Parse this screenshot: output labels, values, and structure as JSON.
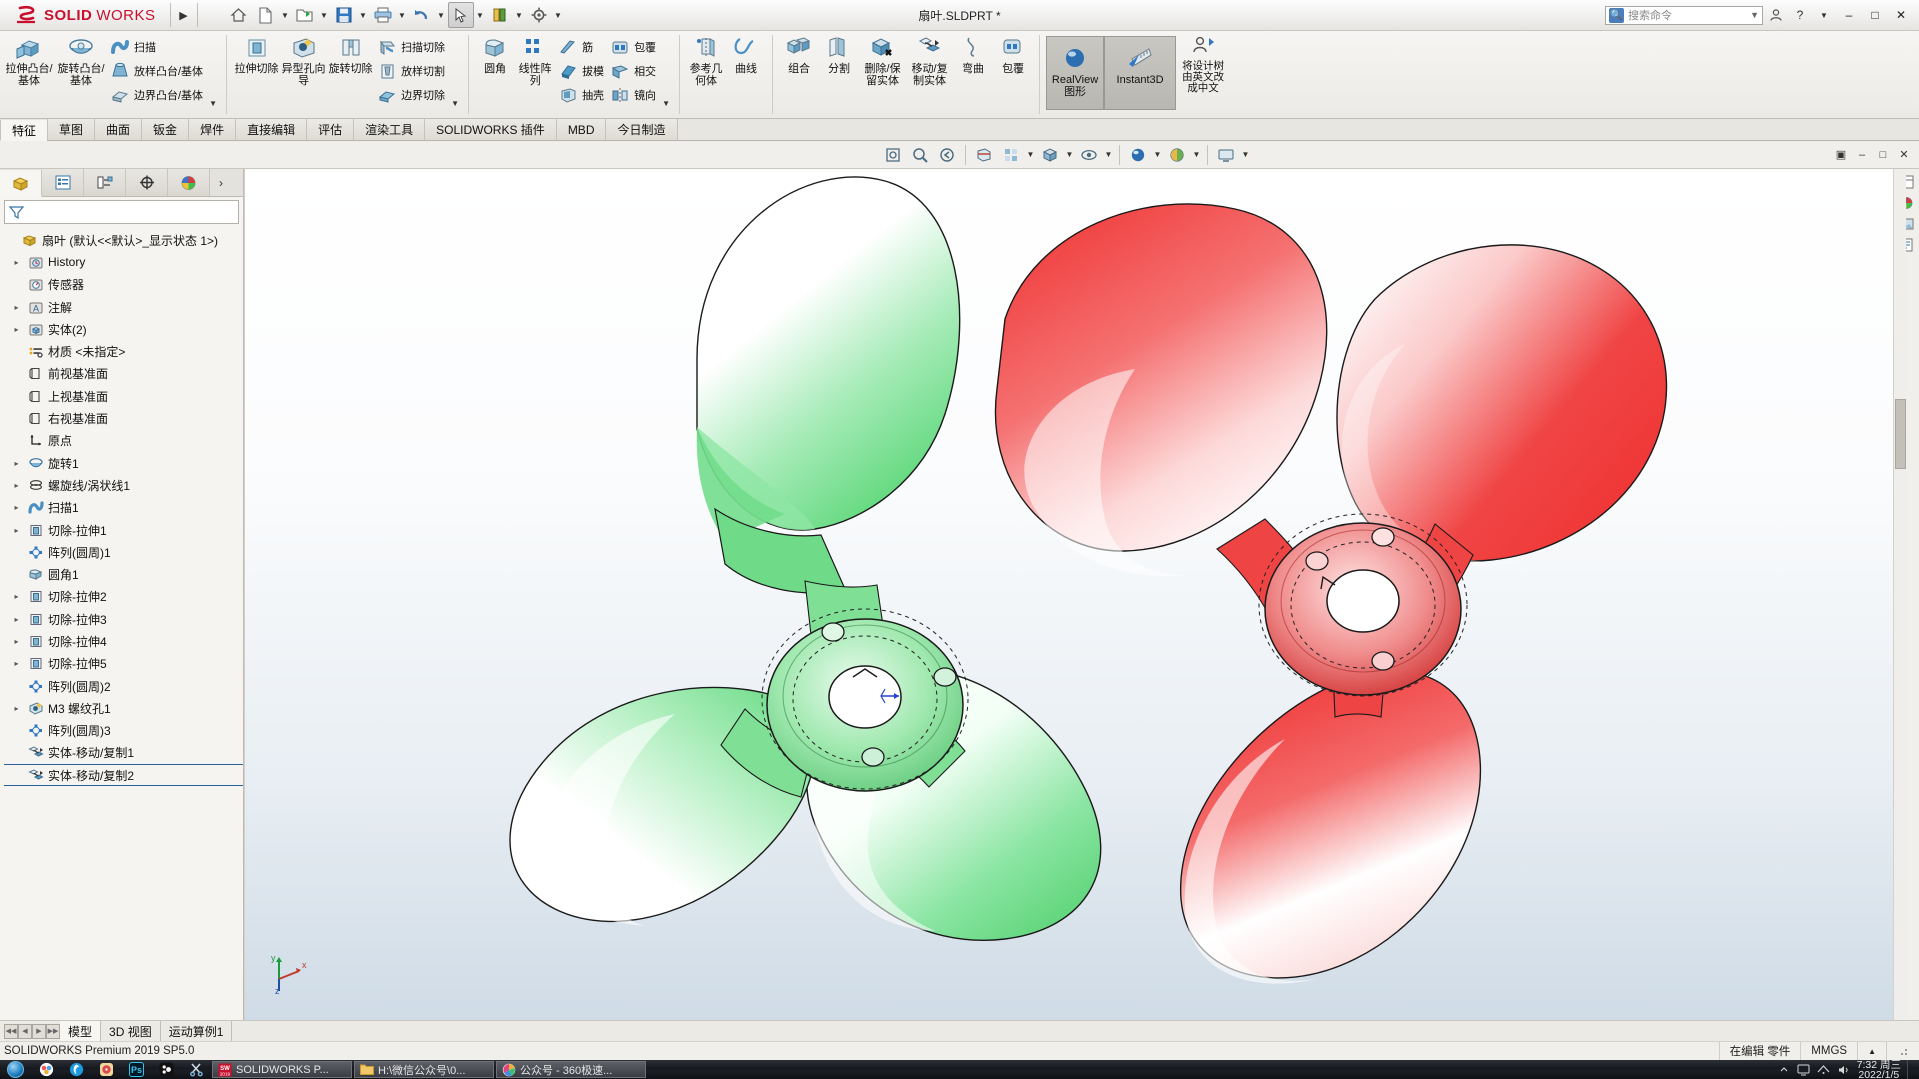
{
  "titlebar": {
    "brand_ds": "3DS",
    "brand_solid": "SOLID",
    "brand_works": "WORKS",
    "expand_arrow": "▶",
    "doc_title": "扇叶.SLDPRT *",
    "quick_access": [
      {
        "name": "home-icon",
        "label": "主页"
      },
      {
        "name": "new-doc-icon",
        "label": "新建"
      },
      {
        "name": "open-icon",
        "label": "打开"
      },
      {
        "name": "save-icon",
        "label": "保存"
      },
      {
        "name": "print-icon",
        "label": "打印"
      },
      {
        "name": "undo-icon",
        "label": "撤销"
      },
      {
        "name": "select-icon",
        "label": "选择"
      },
      {
        "name": "rebuild-icon",
        "label": "重建模型"
      },
      {
        "name": "settings-icon",
        "label": "选项"
      }
    ],
    "search_placeholder": "搜索命令",
    "help_label": "?",
    "minimize": "–",
    "maximize": "□",
    "close": "✕"
  },
  "ribbon": {
    "groups": [
      {
        "name": "boss-base-group",
        "big": [
          {
            "label": "拉伸凸台/基体",
            "icon": "extrude-boss-icon"
          },
          {
            "label": "旋转凸台/基体",
            "icon": "revolve-boss-icon"
          }
        ],
        "small": [
          {
            "label": "扫描",
            "icon": "sweep-icon"
          },
          {
            "label": "放样凸台/基体",
            "icon": "loft-icon"
          },
          {
            "label": "边界凸台/基体",
            "icon": "boundary-boss-icon"
          }
        ],
        "caret": "▼"
      },
      {
        "name": "cut-group",
        "big": [
          {
            "label": "拉伸切除",
            "icon": "extrude-cut-icon"
          },
          {
            "label": "异型孔向导",
            "icon": "hole-wizard-icon"
          },
          {
            "label": "旋转切除",
            "icon": "revolve-cut-icon"
          }
        ],
        "small": [
          {
            "label": "扫描切除",
            "icon": "sweep-cut-icon"
          },
          {
            "label": "放样切割",
            "icon": "loft-cut-icon"
          },
          {
            "label": "边界切除",
            "icon": "boundary-cut-icon"
          }
        ],
        "caret": "▼"
      },
      {
        "name": "feature-group",
        "big": [
          {
            "label": "圆角",
            "icon": "fillet-icon"
          },
          {
            "label": "线性阵列",
            "icon": "linear-pattern-icon"
          }
        ],
        "small": [
          {
            "label": "筋",
            "icon": "rib-icon"
          },
          {
            "label": "拔模",
            "icon": "draft-icon"
          },
          {
            "label": "抽壳",
            "icon": "shell-icon"
          }
        ],
        "small2": [
          {
            "label": "包覆",
            "icon": "wrap-icon"
          },
          {
            "label": "相交",
            "icon": "intersect-icon"
          },
          {
            "label": "镜向",
            "icon": "mirror-icon"
          }
        ],
        "caret": "▼"
      },
      {
        "name": "reference-group",
        "big": [
          {
            "label": "参考几何体",
            "icon": "reference-geometry-icon"
          },
          {
            "label": "曲线",
            "icon": "curves-icon"
          }
        ]
      },
      {
        "name": "bodies-group",
        "big": [
          {
            "label": "组合",
            "icon": "combine-icon"
          },
          {
            "label": "分割",
            "icon": "split-icon"
          },
          {
            "label": "删除/保留实体",
            "icon": "delete-keep-body-icon"
          },
          {
            "label": "移动/复制实体",
            "icon": "move-copy-body-icon"
          },
          {
            "label": "弯曲",
            "icon": "flex-icon"
          },
          {
            "label": "包覆",
            "icon": "wrap2-icon"
          }
        ]
      },
      {
        "name": "display-group",
        "toggles": [
          {
            "label": "RealView 图形",
            "icon": "realview-icon",
            "active": true
          },
          {
            "label": "Instant3D",
            "icon": "instant3d-icon",
            "active": true
          }
        ],
        "big": [
          {
            "label": "将设计树由英文改成中文",
            "icon": "translate-tree-icon"
          }
        ]
      }
    ]
  },
  "command_tabs": {
    "items": [
      {
        "label": "特征",
        "active": true
      },
      {
        "label": "草图",
        "active": false
      },
      {
        "label": "曲面",
        "active": false
      },
      {
        "label": "钣金",
        "active": false
      },
      {
        "label": "焊件",
        "active": false
      },
      {
        "label": "直接编辑",
        "active": false
      },
      {
        "label": "评估",
        "active": false
      },
      {
        "label": "渲染工具",
        "active": false
      },
      {
        "label": "SOLIDWORKS 插件",
        "active": false
      },
      {
        "label": "MBD",
        "active": false
      },
      {
        "label": "今日制造",
        "active": false
      }
    ]
  },
  "view_toolbar": {
    "buttons": [
      {
        "name": "zoom-to-fit-icon",
        "label": "整屏显示全图"
      },
      {
        "name": "zoom-to-area-icon",
        "label": "局部放大"
      },
      {
        "name": "previous-view-icon",
        "label": "上一视图"
      },
      {
        "name": "section-view-icon",
        "label": "剖面视图"
      },
      {
        "name": "view-orientation-icon",
        "label": "视图定向"
      },
      {
        "name": "display-style-icon",
        "label": "显示样式"
      },
      {
        "name": "hide-show-icon",
        "label": "隐藏/显示项目"
      },
      {
        "name": "edit-appearance-icon",
        "label": "编辑外观"
      },
      {
        "name": "apply-scene-icon",
        "label": "应用布景"
      },
      {
        "name": "view-settings-icon",
        "label": "视图设定"
      }
    ],
    "right_buttons": [
      {
        "name": "restore-window-icon",
        "label": "还原"
      },
      {
        "name": "minimize-window-icon",
        "label": "最小化"
      },
      {
        "name": "maximize-window-icon",
        "label": "最大化"
      },
      {
        "name": "close-window-icon",
        "label": "关闭"
      }
    ]
  },
  "left_panel": {
    "tabs": [
      {
        "name": "feature-manager-tab",
        "icon": "feature-tree-icon",
        "active": true
      },
      {
        "name": "property-manager-tab",
        "icon": "property-list-icon",
        "active": false
      },
      {
        "name": "configuration-manager-tab",
        "icon": "configuration-icon",
        "active": false
      },
      {
        "name": "dimxpert-manager-tab",
        "icon": "dimxpert-icon",
        "active": false
      },
      {
        "name": "display-manager-tab",
        "icon": "appearance-sphere-icon",
        "active": false
      }
    ],
    "more_tabs": "›",
    "filter_placeholder": "",
    "tree": [
      {
        "label": "扇叶  (默认<<默认>_显示状态 1>)",
        "icon": "part-icon",
        "arrow": "",
        "indent": 0
      },
      {
        "label": "History",
        "icon": "history-icon",
        "arrow": "▸",
        "indent": 1
      },
      {
        "label": "传感器",
        "icon": "sensor-icon",
        "arrow": "",
        "indent": 1
      },
      {
        "label": "注解",
        "icon": "annotation-icon",
        "arrow": "▸",
        "indent": 1
      },
      {
        "label": "实体(2)",
        "icon": "solid-bodies-icon",
        "arrow": "▸",
        "indent": 1
      },
      {
        "label": "材质 <未指定>",
        "icon": "material-icon",
        "arrow": "",
        "indent": 1
      },
      {
        "label": "前视基准面",
        "icon": "plane-icon",
        "arrow": "",
        "indent": 1
      },
      {
        "label": "上视基准面",
        "icon": "plane-icon",
        "arrow": "",
        "indent": 1
      },
      {
        "label": "右视基准面",
        "icon": "plane-icon",
        "arrow": "",
        "indent": 1
      },
      {
        "label": "原点",
        "icon": "origin-icon",
        "arrow": "",
        "indent": 1
      },
      {
        "label": "旋转1",
        "icon": "revolve-icon",
        "arrow": "▸",
        "indent": 1
      },
      {
        "label": "螺旋线/涡状线1",
        "icon": "helix-icon",
        "arrow": "▸",
        "indent": 1
      },
      {
        "label": "扫描1",
        "icon": "sweep-feature-icon",
        "arrow": "▸",
        "indent": 1
      },
      {
        "label": "切除-拉伸1",
        "icon": "extrude-cut-feature-icon",
        "arrow": "▸",
        "indent": 1
      },
      {
        "label": "阵列(圆周)1",
        "icon": "circular-pattern-icon",
        "arrow": "",
        "indent": 1
      },
      {
        "label": "圆角1",
        "icon": "fillet-feature-icon",
        "arrow": "",
        "indent": 1
      },
      {
        "label": "切除-拉伸2",
        "icon": "extrude-cut-feature-icon",
        "arrow": "▸",
        "indent": 1
      },
      {
        "label": "切除-拉伸3",
        "icon": "extrude-cut-feature-icon",
        "arrow": "▸",
        "indent": 1
      },
      {
        "label": "切除-拉伸4",
        "icon": "extrude-cut-feature-icon",
        "arrow": "▸",
        "indent": 1
      },
      {
        "label": "切除-拉伸5",
        "icon": "extrude-cut-feature-icon",
        "arrow": "▸",
        "indent": 1
      },
      {
        "label": "阵列(圆周)2",
        "icon": "circular-pattern-icon",
        "arrow": "",
        "indent": 1
      },
      {
        "label": "M3 螺纹孔1",
        "icon": "hole-wizard-feature-icon",
        "arrow": "▸",
        "indent": 1
      },
      {
        "label": "阵列(圆周)3",
        "icon": "circular-pattern-icon",
        "arrow": "",
        "indent": 1
      },
      {
        "label": "实体-移动/复制1",
        "icon": "move-copy-feature-icon",
        "arrow": "",
        "indent": 1
      },
      {
        "label": "实体-移动/复制2",
        "icon": "move-copy-feature-icon",
        "arrow": "",
        "indent": 1,
        "selected": true
      }
    ]
  },
  "graphics": {
    "axis_x": "x",
    "axis_y": "y",
    "axis_z": "z",
    "green_body_color": "#6fdd86",
    "red_body_color": "#ef3a3a",
    "background_top": "#ffffff",
    "background_bottom": "#cfdbe6"
  },
  "bottom_tabs": {
    "nav": [
      "⏮",
      "◀",
      "▶",
      "⏭"
    ],
    "items": [
      {
        "label": "模型",
        "active": true
      },
      {
        "label": "3D 视图",
        "active": false
      },
      {
        "label": "运动算例1",
        "active": false
      }
    ]
  },
  "status_bar": {
    "left": "SOLIDWORKS Premium 2019 SP5.0",
    "edit_state": "在编辑 零件",
    "units": "MMGS",
    "units_caret": "▲"
  },
  "taskbar": {
    "start_label": "开始",
    "pinned": [
      {
        "name": "browser-icon",
        "color": "#ffffff"
      },
      {
        "name": "cloud-app-icon",
        "color": "#1b9ae0"
      },
      {
        "name": "media-app-icon",
        "color": "#e05b5b"
      },
      {
        "name": "photoshop-icon",
        "label": "Ps",
        "color": "#31c5f0"
      },
      {
        "name": "design-app-icon",
        "color": "#ffffff"
      },
      {
        "name": "snip-tool-icon",
        "color": "#d8d8d8"
      }
    ],
    "tasks": [
      {
        "name": "solidworks-task",
        "label": "SOLIDWORKS P...",
        "icon_label": "SW",
        "icon_year": "2019"
      },
      {
        "name": "explorer-task",
        "label": "H:\\微信公众号\\0...",
        "icon": "folder-icon"
      },
      {
        "name": "browser-task",
        "label": "公众号 - 360极速...",
        "icon": "360-browser-icon"
      }
    ],
    "tray": [
      {
        "name": "monitor-tray-icon"
      },
      {
        "name": "network-tray-icon"
      },
      {
        "name": "volume-tray-icon"
      }
    ],
    "clock_time": "7:32",
    "clock_weekday": "周三",
    "clock_date": "2022/1/5",
    "show_desktop": ""
  }
}
